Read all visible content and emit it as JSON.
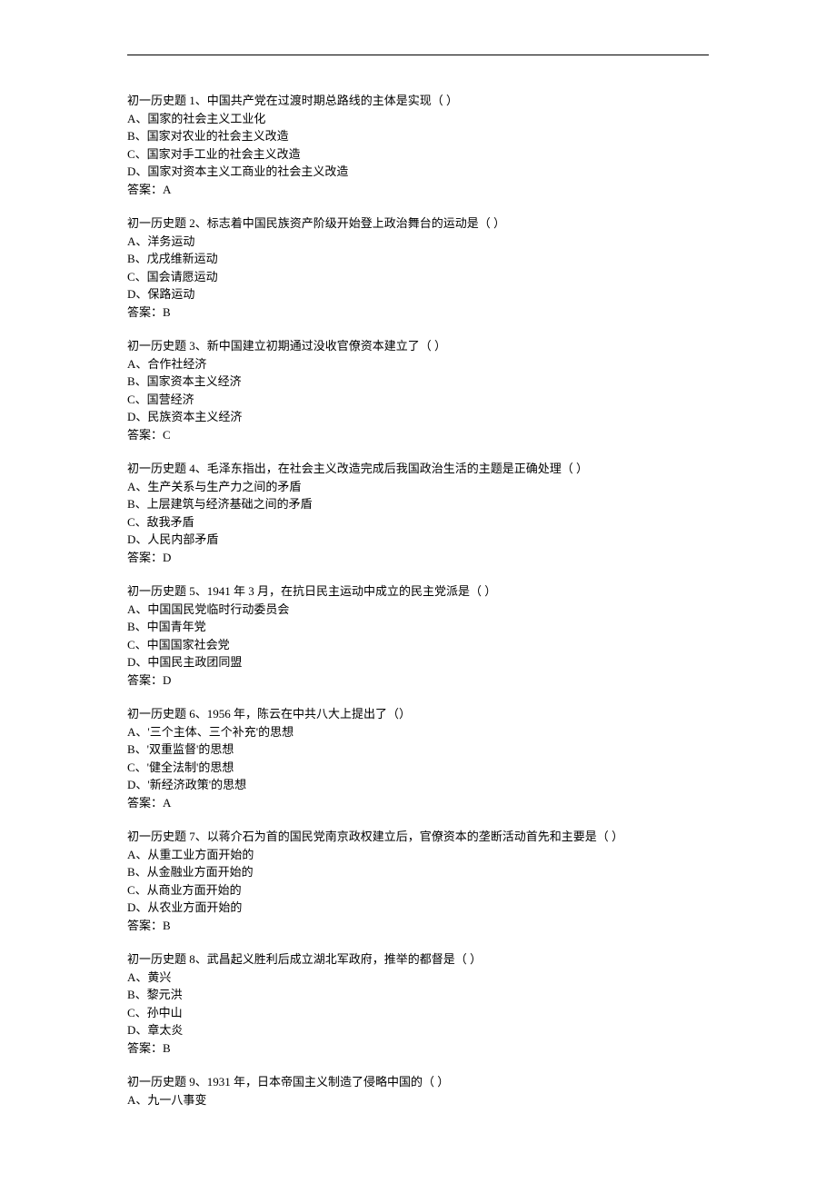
{
  "questions": [
    {
      "stem": "初一历史题 1、中国共产党在过渡时期总路线的主体是实现（ ）",
      "options": [
        "A、国家的社会主义工业化",
        "B、国家对农业的社会主义改造",
        "C、国家对手工业的社会主义改造",
        "D、国家对资本主义工商业的社会主义改造"
      ],
      "answer_label": "答案：",
      "answer": "A"
    },
    {
      "stem": "初一历史题 2、标志着中国民族资产阶级开始登上政治舞台的运动是（ ）",
      "options": [
        "A、洋务运动",
        "B、戊戌维新运动",
        "C、国会请愿运动",
        "D、保路运动"
      ],
      "answer_label": "答案：",
      "answer": "B"
    },
    {
      "stem": "初一历史题 3、新中国建立初期通过没收官僚资本建立了（ ）",
      "options": [
        "A、合作社经济",
        "B、国家资本主义经济",
        "C、国营经济",
        "D、民族资本主义经济"
      ],
      "answer_label": "答案：",
      "answer": "C"
    },
    {
      "stem": "初一历史题 4、毛泽东指出，在社会主义改造完成后我国政治生活的主题是正确处理（ ）",
      "options": [
        "A、生产关系与生产力之间的矛盾",
        "B、上层建筑与经济基础之间的矛盾",
        "C、敌我矛盾",
        "D、人民内部矛盾"
      ],
      "answer_label": "答案：",
      "answer": "D"
    },
    {
      "stem": "初一历史题 5、1941 年 3 月，在抗日民主运动中成立的民主党派是（ ）",
      "options": [
        "A、中国国民党临时行动委员会",
        "B、中国青年党",
        "C、中国国家社会党",
        "D、中国民主政团同盟"
      ],
      "answer_label": "答案：",
      "answer": "D"
    },
    {
      "stem": "初一历史题 6、1956 年，陈云在中共八大上提出了（）",
      "options": [
        "A、'三个主体、三个补充'的思想",
        "B、'双重监督'的思想",
        "C、'健全法制'的思想",
        "D、'新经济政策'的思想"
      ],
      "answer_label": "答案：",
      "answer": "A"
    },
    {
      "stem": "初一历史题 7、以蒋介石为首的国民党南京政权建立后，官僚资本的垄断活动首先和主要是（ ）",
      "options": [
        "A、从重工业方面开始的",
        "B、从金融业方面开始的",
        "C、从商业方面开始的",
        "D、从农业方面开始的"
      ],
      "answer_label": "答案：",
      "answer": "B"
    },
    {
      "stem": "初一历史题 8、武昌起义胜利后成立湖北军政府，推举的都督是（ ）",
      "options": [
        "A、黄兴",
        "B、黎元洪",
        "C、孙中山",
        "D、章太炎"
      ],
      "answer_label": "答案：",
      "answer": "B"
    },
    {
      "stem": "初一历史题 9、1931 年，日本帝国主义制造了侵略中国的（ ）",
      "options": [
        "A、九一八事变"
      ],
      "answer_label": "",
      "answer": ""
    }
  ]
}
